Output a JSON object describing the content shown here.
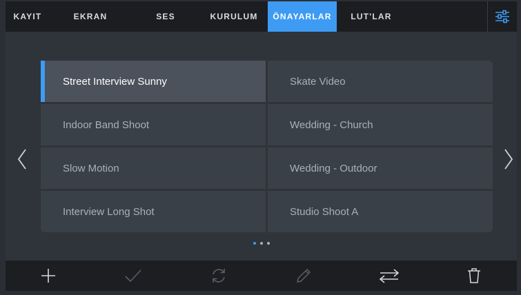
{
  "tabs": [
    {
      "label": "KAYIT",
      "active": false
    },
    {
      "label": "EKRAN",
      "active": false
    },
    {
      "label": "SES",
      "active": false
    },
    {
      "label": "KURULUM",
      "active": false
    },
    {
      "label": "ÖNAYARLAR",
      "active": true
    },
    {
      "label": "LUT'LAR",
      "active": false
    }
  ],
  "settings_icon": "sliders-icon",
  "presets": [
    {
      "label": "Street Interview Sunny",
      "selected": true
    },
    {
      "label": "Skate Video",
      "selected": false
    },
    {
      "label": "Indoor Band Shoot",
      "selected": false
    },
    {
      "label": "Wedding  - Church",
      "selected": false
    },
    {
      "label": "Slow Motion",
      "selected": false
    },
    {
      "label": "Wedding - Outdoor",
      "selected": false
    },
    {
      "label": "Interview Long Shot",
      "selected": false
    },
    {
      "label": "Studio Shoot A",
      "selected": false
    }
  ],
  "pagination": {
    "pages": 3,
    "current": 1
  },
  "toolbar_icons": [
    "plus-icon",
    "checkmark-icon",
    "refresh-icon",
    "pencil-icon",
    "swap-arrows-icon",
    "trash-icon"
  ],
  "colors": {
    "accent": "#3e9bf3",
    "tabbar": "#1b1d20",
    "background": "#2f343a",
    "cell": "#3a4048",
    "cell_selected": "#4b525b"
  }
}
